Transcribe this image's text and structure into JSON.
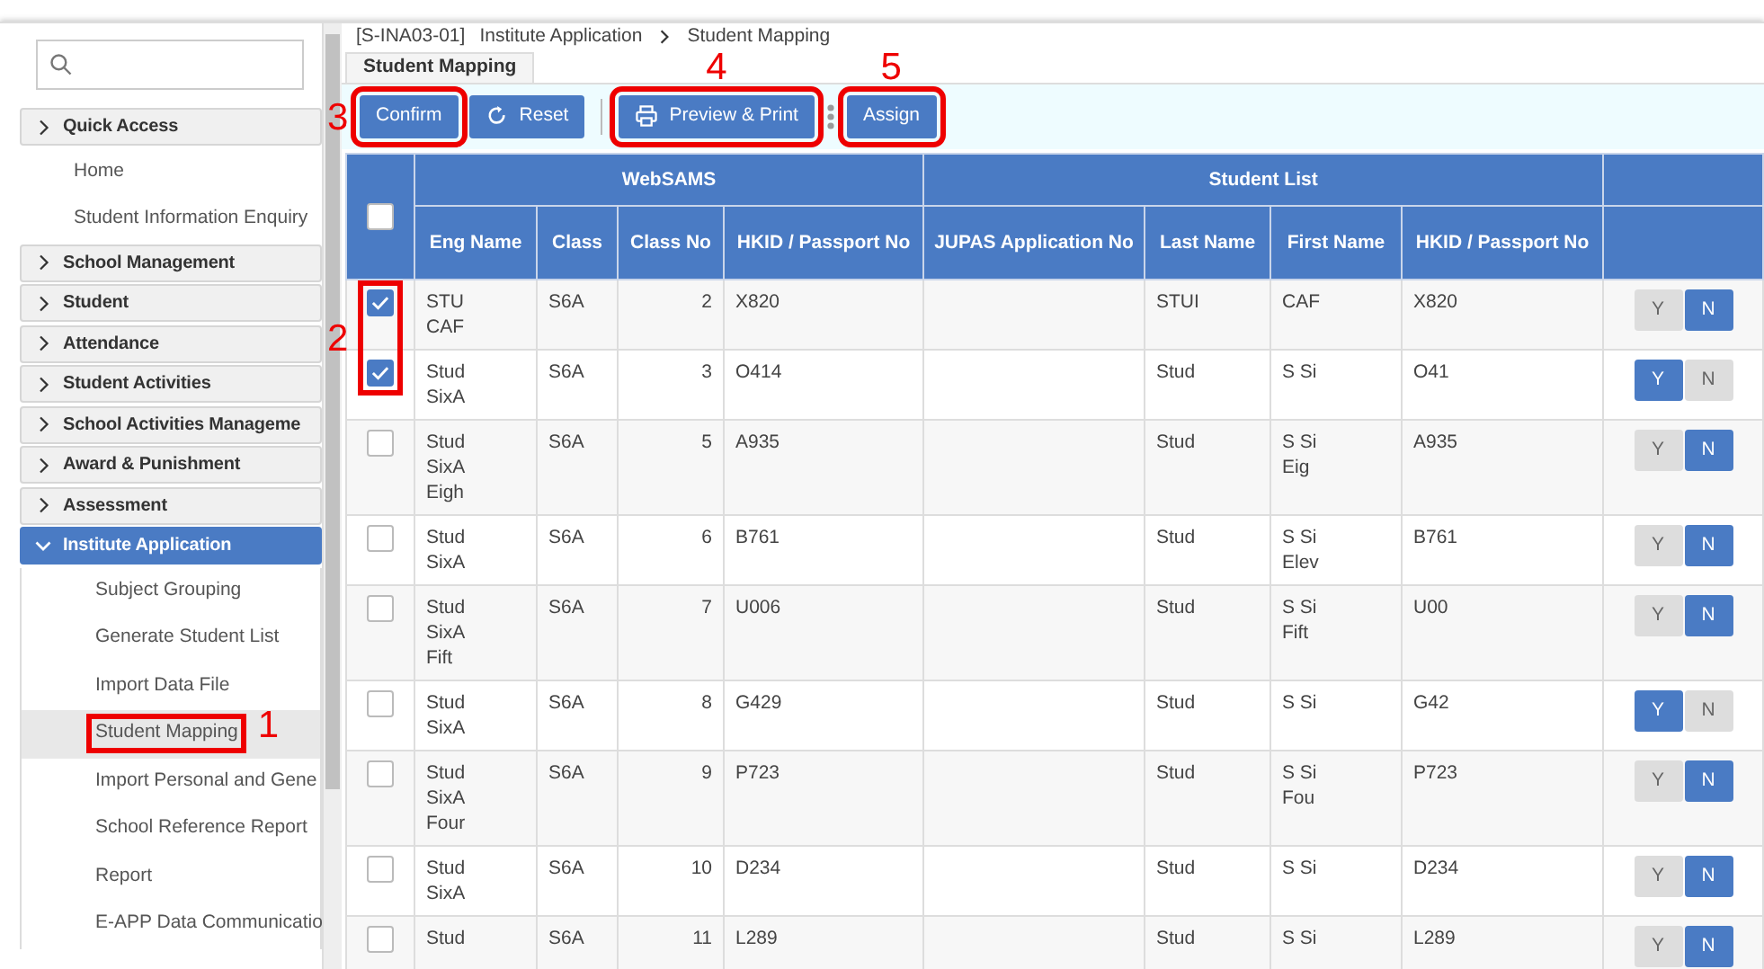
{
  "sidebar": {
    "sections": [
      {
        "label": "Quick Access",
        "expanded": false,
        "items": [
          {
            "label": "Home",
            "selected": false
          },
          {
            "label": "Student Information Enquiry",
            "selected": false
          }
        ]
      },
      {
        "label": "School Management",
        "expanded": false
      },
      {
        "label": "Student",
        "expanded": false
      },
      {
        "label": "Attendance",
        "expanded": false
      },
      {
        "label": "Student Activities",
        "expanded": false
      },
      {
        "label": "School Activities Manageme",
        "expanded": false
      },
      {
        "label": "Award & Punishment",
        "expanded": false
      },
      {
        "label": "Assessment",
        "expanded": false
      },
      {
        "label": "Institute Application",
        "expanded": true,
        "items": [
          {
            "label": "Subject Grouping",
            "selected": false
          },
          {
            "label": "Generate Student List",
            "selected": false
          },
          {
            "label": "Import Data File",
            "selected": false
          },
          {
            "label": "Student Mapping",
            "selected": true,
            "callout": "1"
          },
          {
            "label": "Import Personal and Gene",
            "selected": false
          },
          {
            "label": "School Reference Report",
            "selected": false
          },
          {
            "label": "Report",
            "selected": false
          },
          {
            "label": "E-APP Data Communicatio",
            "selected": false
          }
        ]
      }
    ]
  },
  "breadcrumb": [
    "[S-INA03-01]",
    "Institute Application",
    "Student Mapping"
  ],
  "tabs": [
    {
      "label": "Student Mapping",
      "selected": true
    }
  ],
  "toolbar": [
    {
      "kind": "button",
      "label": "Confirm",
      "callout": "3"
    },
    {
      "kind": "reset",
      "label": "Reset"
    },
    {
      "kind": "divider"
    },
    {
      "kind": "print",
      "label": "Preview & Print",
      "callout": "4"
    },
    {
      "kind": "dots"
    },
    {
      "kind": "button",
      "label": "Assign",
      "callout": "5"
    }
  ],
  "table": {
    "groups": [
      "WebSAMS",
      "Student List"
    ],
    "columns": [
      "Eng Name",
      "Class",
      "Class No",
      "HKID / Passport No",
      "JUPAS Application No",
      "Last Name",
      "First Name",
      "HKID / Passport No"
    ],
    "select_all": false,
    "checkbox_callout": "2",
    "rows": [
      {
        "checked": true,
        "in_callout": true,
        "eng_name": [
          "STU",
          "CAF"
        ],
        "class": "S6A",
        "class_no": "2",
        "hkid": "X820",
        "last_name": "STUI",
        "first_name": [
          "CAF"
        ],
        "hkid2": "X820",
        "options": [
          {
            "label": "Y",
            "selected": false
          },
          {
            "label": "N",
            "selected": true
          }
        ]
      },
      {
        "checked": true,
        "in_callout": true,
        "eng_name": [
          "Stud",
          "SixA"
        ],
        "class": "S6A",
        "class_no": "3",
        "hkid": "O414",
        "last_name": "Stud",
        "first_name": [
          "S Si"
        ],
        "hkid2": "O41",
        "options": [
          {
            "label": "Y",
            "selected": true
          },
          {
            "label": "N",
            "selected": false
          }
        ]
      },
      {
        "checked": false,
        "eng_name": [
          "Stud",
          "SixA",
          "Eigh"
        ],
        "class": "S6A",
        "class_no": "5",
        "hkid": "A935",
        "last_name": "Stud",
        "first_name": [
          "S Si",
          "Eig"
        ],
        "hkid2": "A935",
        "options": [
          {
            "label": "Y",
            "selected": false
          },
          {
            "label": "N",
            "selected": true
          }
        ]
      },
      {
        "checked": false,
        "eng_name": [
          "Stud",
          "SixA"
        ],
        "class": "S6A",
        "class_no": "6",
        "hkid": "B761",
        "last_name": "Stud",
        "first_name": [
          "S Si",
          "Elev"
        ],
        "hkid2": "B761",
        "options": [
          {
            "label": "Y",
            "selected": false
          },
          {
            "label": "N",
            "selected": true
          }
        ]
      },
      {
        "checked": false,
        "eng_name": [
          "Stud",
          "SixA",
          "Fift"
        ],
        "class": "S6A",
        "class_no": "7",
        "hkid": "U006",
        "last_name": "Stud",
        "first_name": [
          "S Si",
          "Fift"
        ],
        "hkid2": "U00",
        "options": [
          {
            "label": "Y",
            "selected": false
          },
          {
            "label": "N",
            "selected": true
          }
        ]
      },
      {
        "checked": false,
        "eng_name": [
          "Stud",
          "SixA"
        ],
        "class": "S6A",
        "class_no": "8",
        "hkid": "G429",
        "last_name": "Stud",
        "first_name": [
          "S Si"
        ],
        "hkid2": "G42",
        "options": [
          {
            "label": "Y",
            "selected": true
          },
          {
            "label": "N",
            "selected": false
          }
        ]
      },
      {
        "checked": false,
        "eng_name": [
          "Stud",
          "SixA",
          "Four"
        ],
        "class": "S6A",
        "class_no": "9",
        "hkid": "P723",
        "last_name": "Stud",
        "first_name": [
          "S Si",
          "Fou"
        ],
        "hkid2": "P723",
        "options": [
          {
            "label": "Y",
            "selected": false
          },
          {
            "label": "N",
            "selected": true
          }
        ]
      },
      {
        "checked": false,
        "eng_name": [
          "Stud",
          "SixA"
        ],
        "class": "S6A",
        "class_no": "10",
        "hkid": "D234",
        "last_name": "Stud",
        "first_name": [
          "S Si"
        ],
        "hkid2": "D234",
        "options": [
          {
            "label": "Y",
            "selected": false
          },
          {
            "label": "N",
            "selected": true
          }
        ]
      },
      {
        "checked": false,
        "eng_name": [
          "Stud"
        ],
        "class": "S6A",
        "class_no": "11",
        "hkid": "L289",
        "last_name": "Stud",
        "first_name": [
          "S Si"
        ],
        "hkid2": "L289",
        "options": [
          {
            "label": "Y",
            "selected": false
          },
          {
            "label": "N",
            "selected": true
          }
        ]
      }
    ]
  }
}
